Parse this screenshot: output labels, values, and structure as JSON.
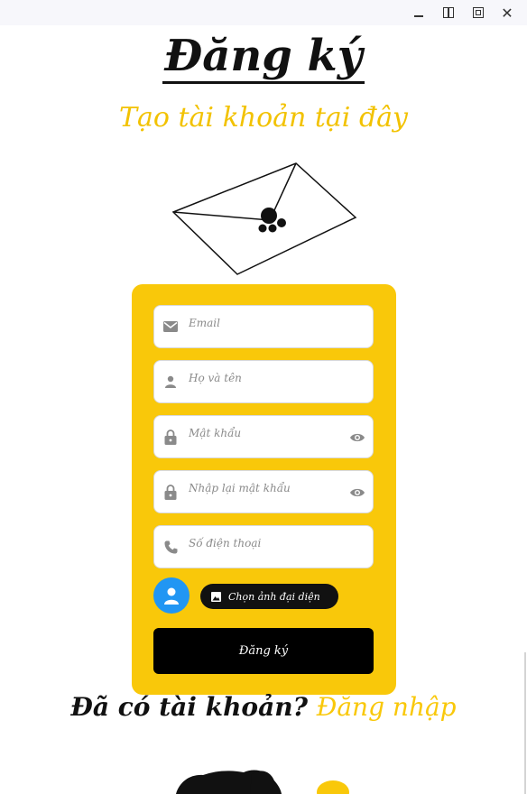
{
  "window": {
    "close_glyph": "✕"
  },
  "header": {
    "title": "Đăng ký",
    "subtitle": "Tạo tài khoản tại đây"
  },
  "form": {
    "email_placeholder": "Email",
    "name_placeholder": "Họ và tên",
    "password_placeholder": "Mật khẩu",
    "confirm_password_placeholder": "Nhập lại mật khẩu",
    "phone_placeholder": "Số điện thoại",
    "choose_avatar_label": "Chọn ảnh đại diện",
    "submit_label": "Đăng ký"
  },
  "footer": {
    "question": "Đã có tài khoản?",
    "login_link": "Đăng nhập"
  },
  "colors": {
    "accent_yellow": "#f9c80a",
    "avatar_blue": "#2196f3",
    "button_black": "#000000"
  },
  "icons": [
    "email-icon",
    "person-icon",
    "lock-icon",
    "eye-icon",
    "phone-icon",
    "image-icon",
    "envelope-illustration",
    "mascot-illustration"
  ]
}
